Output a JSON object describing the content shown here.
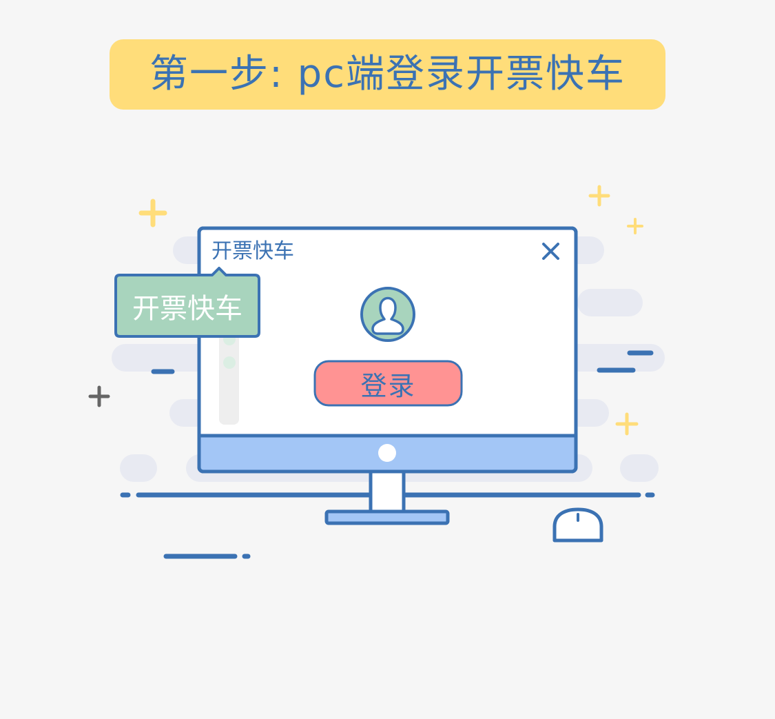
{
  "banner": {
    "title": "第一步: pc端登录开票快车"
  },
  "window": {
    "title": "开票快车",
    "login_label": "登录"
  },
  "tooltip": {
    "text": "开票快车"
  },
  "colors": {
    "background": "#f6f6f6",
    "banner": "#ffdd7a",
    "primary_blue": "#3b72b3",
    "screen_base": "#a3c6f6",
    "avatar_green": "#a8d4bd",
    "login_red": "#ff9393",
    "sparkle_yellow": "#ffdd7a",
    "cloud_gray": "#e8eaf2"
  },
  "icons": [
    "close-icon",
    "avatar-icon",
    "monitor-icon",
    "mouse-icon",
    "plus-icon"
  ]
}
